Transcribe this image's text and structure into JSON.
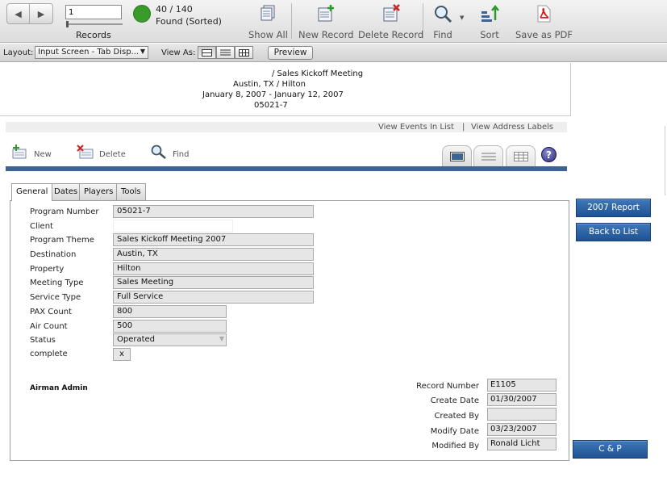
{
  "toolbar": {
    "record_value": "1",
    "records_label": "Records",
    "found_count": "40 / 140",
    "found_label": "Found (Sorted)",
    "buttons": {
      "show_all": "Show All",
      "new_record": "New Record",
      "delete_record": "Delete Record",
      "find": "Find",
      "sort": "Sort",
      "save_pdf": "Save as PDF"
    }
  },
  "layout_bar": {
    "layout_label": "Layout:",
    "layout_value": "Input Screen - Tab Disp...",
    "view_as_label": "View As:",
    "preview_label": "Preview"
  },
  "summary": {
    "line1": "/ Sales Kickoff Meeting",
    "line2": "Austin, TX / Hilton",
    "line3": "January 8, 2007 - January 12, 2007",
    "line4": "05021-7"
  },
  "links": {
    "view_events": "View Events In List",
    "separator": "|",
    "view_labels": "View Address Labels"
  },
  "actions": {
    "new": "New",
    "delete": "Delete",
    "find": "Find",
    "help": "?"
  },
  "tabs": [
    "General",
    "Dates",
    "Players",
    "Tools"
  ],
  "form": {
    "labels": {
      "program_number": "Program Number",
      "client": "Client",
      "program_theme": "Program Theme",
      "destination": "Destination",
      "property": "Property",
      "meeting_type": "Meeting Type",
      "service_type": "Service Type",
      "pax_count": "PAX Count",
      "air_count": "Air Count",
      "status": "Status",
      "complete": "complete"
    },
    "values": {
      "program_number": "05021-7",
      "client": "",
      "program_theme": "Sales Kickoff Meeting 2007",
      "destination": "Austin, TX",
      "property": "Hilton",
      "meeting_type": "Sales Meeting",
      "service_type": "Full Service",
      "pax_count": "800",
      "air_count": "500",
      "status": "Operated",
      "complete": "x"
    },
    "admin_text": "Airman Admin"
  },
  "meta": {
    "labels": {
      "record_number": "Record Number",
      "create_date": "Create Date",
      "created_by": "Created By",
      "modify_date": "Modify Date",
      "modified_by": "Modified By"
    },
    "values": {
      "record_number": "E1105",
      "create_date": "01/30/2007",
      "created_by": "",
      "modify_date": "03/23/2007",
      "modified_by": "Ronald Licht"
    }
  },
  "side_buttons": {
    "report": "2007 Report",
    "back": "Back to List",
    "cp": "C & P"
  },
  "colors": {
    "accent_blue": "#3b6394",
    "button_blue": "#2a5f9e",
    "found_green": "#3a9a2c"
  }
}
